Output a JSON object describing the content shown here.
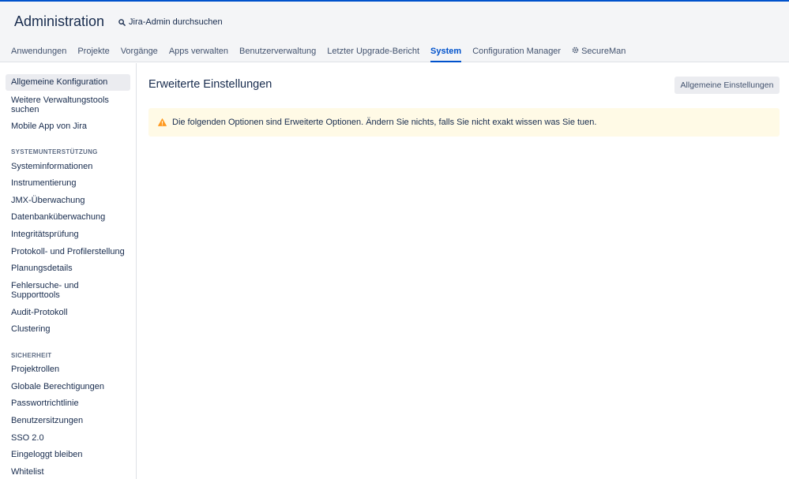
{
  "header": {
    "title": "Administration",
    "search_label": "Jira-Admin durchsuchen"
  },
  "nav": {
    "items": [
      {
        "label": "Anwendungen"
      },
      {
        "label": "Projekte"
      },
      {
        "label": "Vorgänge"
      },
      {
        "label": "Apps verwalten"
      },
      {
        "label": "Benutzerverwaltung"
      },
      {
        "label": "Letzter Upgrade-Bericht"
      },
      {
        "label": "System",
        "active": true
      },
      {
        "label": "Configuration Manager"
      },
      {
        "label": "SecureMan",
        "icon": "gear-icon"
      }
    ]
  },
  "sidebar": {
    "top_items": [
      {
        "label": "Allgemeine Konfiguration",
        "selected": true
      },
      {
        "label": "Weitere Verwaltungstools suchen"
      },
      {
        "label": "Mobile App von Jira"
      }
    ],
    "system_support": {
      "heading": "SYSTEMUNTERSTÜTZUNG",
      "items": [
        {
          "label": "Systeminformationen"
        },
        {
          "label": "Instrumentierung"
        },
        {
          "label": "JMX-Überwachung"
        },
        {
          "label": "Datenbanküberwachung"
        },
        {
          "label": "Integritätsprüfung"
        },
        {
          "label": "Protokoll- und Profilerstellung"
        },
        {
          "label": "Planungsdetails"
        },
        {
          "label": "Fehlersuche- und Supporttools"
        },
        {
          "label": "Audit-Protokoll"
        },
        {
          "label": "Clustering"
        }
      ]
    },
    "security": {
      "heading": "SICHERHEIT",
      "items": [
        {
          "label": "Projektrollen"
        },
        {
          "label": "Globale Berechtigungen"
        },
        {
          "label": "Passwortrichtlinie"
        },
        {
          "label": "Benutzersitzungen"
        },
        {
          "label": "SSO 2.0"
        },
        {
          "label": "Eingeloggt bleiben"
        },
        {
          "label": "Whitelist"
        }
      ]
    }
  },
  "main": {
    "title": "Erweiterte Einstellungen",
    "general_settings_button": "Allgemeine Einstellungen",
    "warning": {
      "icon": "warning-icon",
      "text": "Die folgenden Optionen sind Erweiterte Optionen. Ändern Sie nichts, falls Sie nicht exakt wissen was Sie tuen."
    }
  },
  "colors": {
    "accent": "#0052cc",
    "warning_bg": "#fffae6",
    "warning_icon": "#ff991f",
    "header_bg": "#f4f5f7"
  }
}
